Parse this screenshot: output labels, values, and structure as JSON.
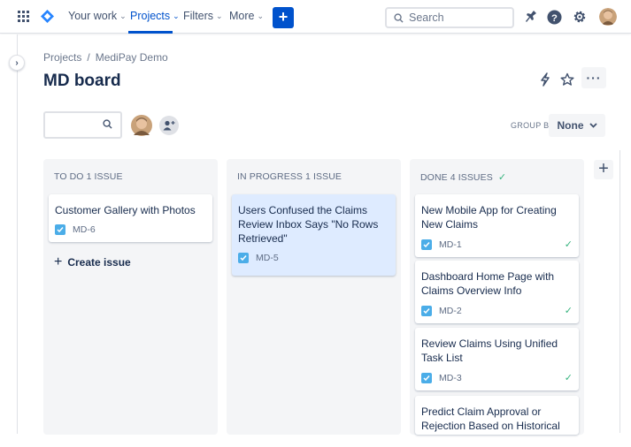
{
  "nav": {
    "your_work": "Your work",
    "projects": "Projects",
    "filters": "Filters",
    "more": "More",
    "create": "+",
    "search_placeholder": "Search"
  },
  "breadcrumb": {
    "projects": "Projects",
    "separator": "/",
    "project": "MediPay Demo"
  },
  "page_title": "MD board",
  "toolbar": {
    "group_by_label": "GROUP BY",
    "group_by_value": "None",
    "more_label": "···"
  },
  "columns": [
    {
      "title": "TO DO 1 ISSUE",
      "cards": [
        {
          "summary": "Customer Gallery with Photos",
          "key": "MD-6"
        }
      ],
      "create_issue": "Create issue"
    },
    {
      "title": "IN PROGRESS 1 ISSUE",
      "cards": [
        {
          "summary": "Users Confused the Claims Review Inbox Says \"No Rows Retrieved\"",
          "key": "MD-5"
        }
      ]
    },
    {
      "title": "DONE 4 ISSUES",
      "cards": [
        {
          "summary": "New Mobile App for Creating New Claims",
          "key": "MD-1"
        },
        {
          "summary": "Dashboard Home Page with Claims Overview Info",
          "key": "MD-2"
        },
        {
          "summary": "Review Claims Using Unified Task List",
          "key": "MD-3"
        },
        {
          "summary": "Predict Claim Approval or Rejection Based on Historical",
          "key": ""
        }
      ]
    }
  ],
  "colors": {
    "accent": "#0052cc",
    "done_green": "#36b37e",
    "story_blue": "#4bade8",
    "highlight_card": "#deebff"
  }
}
